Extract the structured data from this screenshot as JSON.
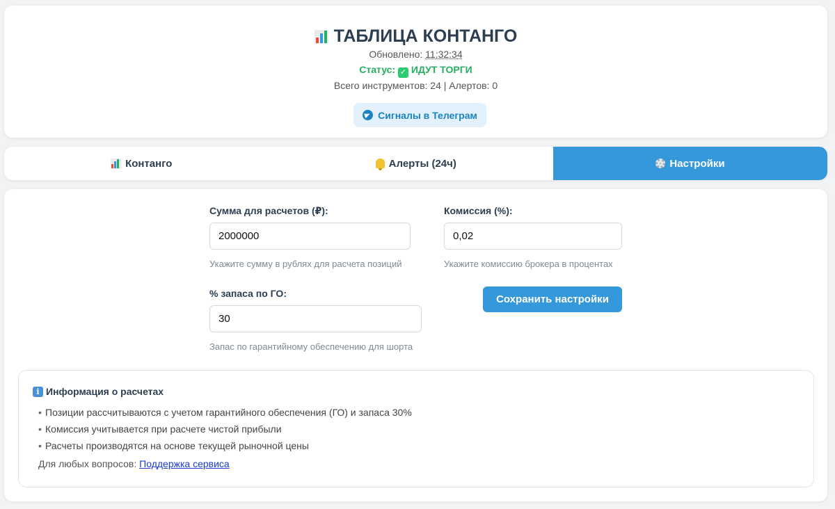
{
  "header": {
    "title": "ТАБЛИЦА КОНТАНГО",
    "updated_label": "Обновлено:",
    "updated_time": "11:32:34",
    "status_label": "Статус:",
    "status_value": "ИДУТ ТОРГИ",
    "totals": "Всего инструментов: 24 | Алертов: 0",
    "telegram_button": "Сигналы в Телеграм"
  },
  "tabs": [
    {
      "label": "Контанго",
      "icon": "bar-chart-icon",
      "active": false
    },
    {
      "label": "Алерты (24ч)",
      "icon": "bell-icon",
      "active": false
    },
    {
      "label": "Настройки",
      "icon": "gear-icon",
      "active": true
    }
  ],
  "settings": {
    "amount": {
      "label": "Сумма для расчетов (₽):",
      "value": "2000000",
      "hint": "Укажите сумму в рублях для расчета позиций"
    },
    "commission": {
      "label": "Комиссия (%):",
      "value": "0,02",
      "hint": "Укажите комиссию брокера в процентах"
    },
    "margin_reserve": {
      "label": "% запаса по ГО:",
      "value": "30",
      "hint": "Запас по гарантийному обеспечению для шорта"
    },
    "save_button": "Сохранить настройки"
  },
  "info": {
    "title": "Информация о расчетах",
    "items": [
      "Позиции рассчитываются с учетом гарантийного обеспечения (ГО) и запаса 30%",
      "Комиссия учитывается при расчете чистой прибыли",
      "Расчеты производятся на основе текущей рыночной цены"
    ],
    "support_text": "Для любых вопросов:",
    "support_link": "Поддержка сервиса"
  },
  "colors": {
    "accent": "#3498db",
    "status_green": "#27ae60",
    "telegram_blue": "#1a82c4",
    "background": "#f2f3f5"
  }
}
